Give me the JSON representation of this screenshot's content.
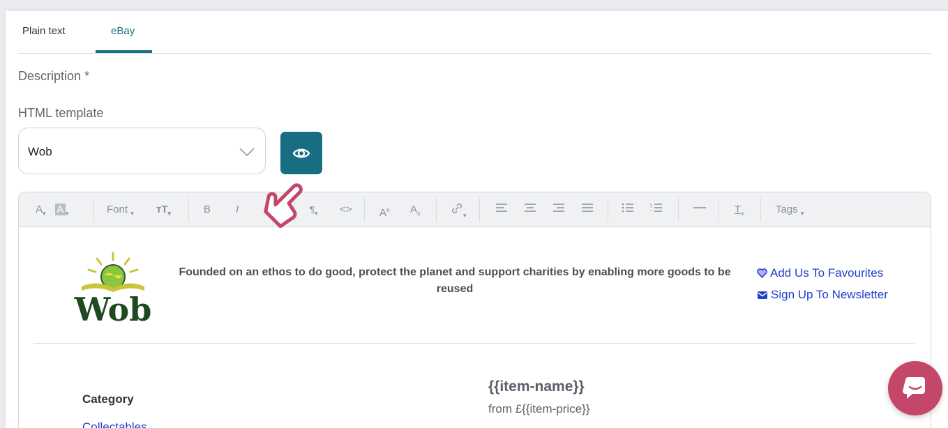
{
  "tabs": [
    {
      "label": "Plain text",
      "active": false
    },
    {
      "label": "eBay",
      "active": true
    }
  ],
  "description_label": "Description *",
  "template_label": "HTML template",
  "template_select": {
    "value": "Wob"
  },
  "toolbar": {
    "font_label": "Font",
    "tags_label": "Tags",
    "heading_glyph": "A",
    "bg_glyph": "A",
    "bold": "B",
    "italic": "I",
    "paragraph": "¶",
    "code": "<>",
    "superscript": "A",
    "subscript": "A",
    "clear": "T"
  },
  "content": {
    "logo_text": "Wob",
    "tagline": "Founded on an ethos to do good, protect the planet and support charities by enabling more goods to be reused",
    "favourites_link": "Add Us To Favourites",
    "newsletter_link": "Sign Up To Newsletter",
    "category_heading": "Category",
    "category_link": "Collectables",
    "item_name": "{{item-name}}",
    "item_price": "from £{{item-price}}"
  },
  "colors": {
    "accent": "#176e83",
    "link": "#2240c8",
    "chat": "#c44668"
  }
}
